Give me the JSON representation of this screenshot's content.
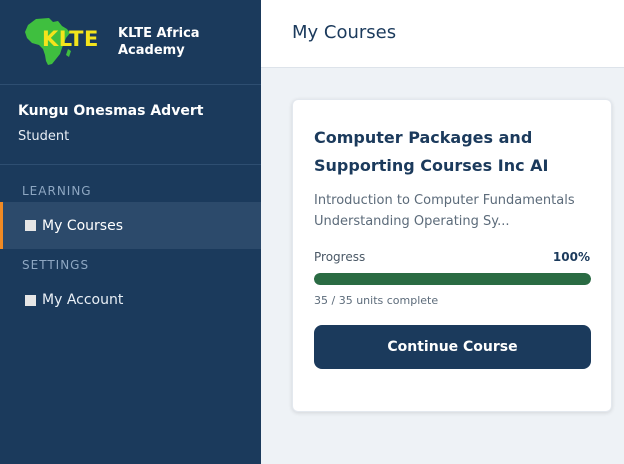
{
  "brand": {
    "logo_text": "KLTE",
    "name": "KLTE Africa Academy",
    "logo_color": "#f4e41c",
    "africa_color": "#3fbf3f"
  },
  "user": {
    "name": "Kungu Onesmas Advert",
    "role": "Student"
  },
  "nav": {
    "learning_label": "LEARNING",
    "settings_label": "SETTINGS",
    "items": [
      {
        "label": "My Courses",
        "icon": "square-icon",
        "active": true
      },
      {
        "label": "My Account",
        "icon": "square-icon",
        "active": false
      }
    ]
  },
  "header": {
    "title": "My Courses"
  },
  "course": {
    "title": "Computer Packages and Supporting Courses Inc AI",
    "description": "Introduction to Computer Fundamentals Understanding Operating Sy...",
    "progress_label": "Progress",
    "progress_text": "100%",
    "progress_fraction": 1.0,
    "units_text": "35 / 35 units complete",
    "button_label": "Continue Course"
  },
  "colors": {
    "sidebar": "#1b3a5c",
    "active_accent": "#f08a24",
    "progress": "#2a6b43"
  }
}
